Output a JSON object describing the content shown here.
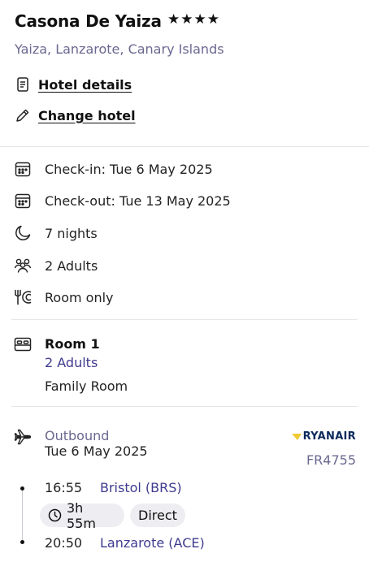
{
  "hotel": {
    "name": "Casona De Yaiza",
    "stars": "★★★★",
    "location": "Yaiza, Lanzarote, Canary Islands"
  },
  "links": {
    "hotel_details": "Hotel details",
    "change_hotel": "Change hotel"
  },
  "stay": {
    "check_in": "Check-in: Tue 6 May 2025",
    "check_out": "Check-out: Tue 13 May 2025",
    "nights": "7 nights",
    "guests": "2 Adults",
    "board": "Room only"
  },
  "room": {
    "title": "Room 1",
    "adults": "2 Adults",
    "type": "Family Room"
  },
  "flight": {
    "label": "Outbound",
    "date": "Tue 6 May 2025",
    "airline": "RYANAIR",
    "flight_number": "FR4755",
    "depart_time": "16:55",
    "depart_airport": "Bristol (BRS)",
    "duration": "3h 55m",
    "stops": "Direct",
    "arrive_time": "20:50",
    "arrive_airport": "Lanzarote (ACE)"
  },
  "colors": {
    "accent": "#3e3b8f",
    "muted": "#6b6890",
    "airline_blue": "#0b2a5c",
    "airline_gold": "#f1c933"
  }
}
